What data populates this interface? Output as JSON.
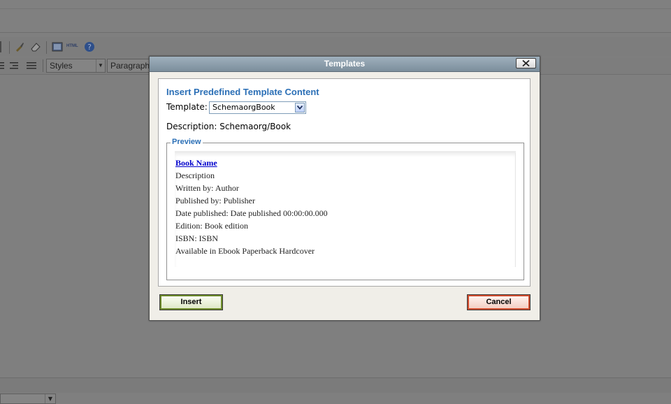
{
  "editor": {
    "toolbar": {
      "html_label": "HTML",
      "styles_select": "Styles",
      "format_select": "Paragraph"
    }
  },
  "dialog": {
    "title": "Templates",
    "heading": "Insert Predefined Template Content",
    "template_label": "Template:",
    "template_value": "SchemaorgBook",
    "description_label": "Description:",
    "description_value": "Schemaorg/Book",
    "preview_legend": "Preview",
    "preview": {
      "book_name": "Book Name",
      "lines": [
        "Description",
        "Written by: Author",
        "Published by: Publisher",
        "Date published: Date published 00:00:00.000",
        "Edition: Book edition",
        "ISBN: ISBN",
        "Available in Ebook Paperback Hardcover"
      ]
    },
    "insert_label": "Insert",
    "cancel_label": "Cancel"
  },
  "colors": {
    "heading": "#2b6fb6",
    "titlebar": "#8a9baa",
    "link": "#0000cc",
    "overlay": "#7f7f7f"
  }
}
